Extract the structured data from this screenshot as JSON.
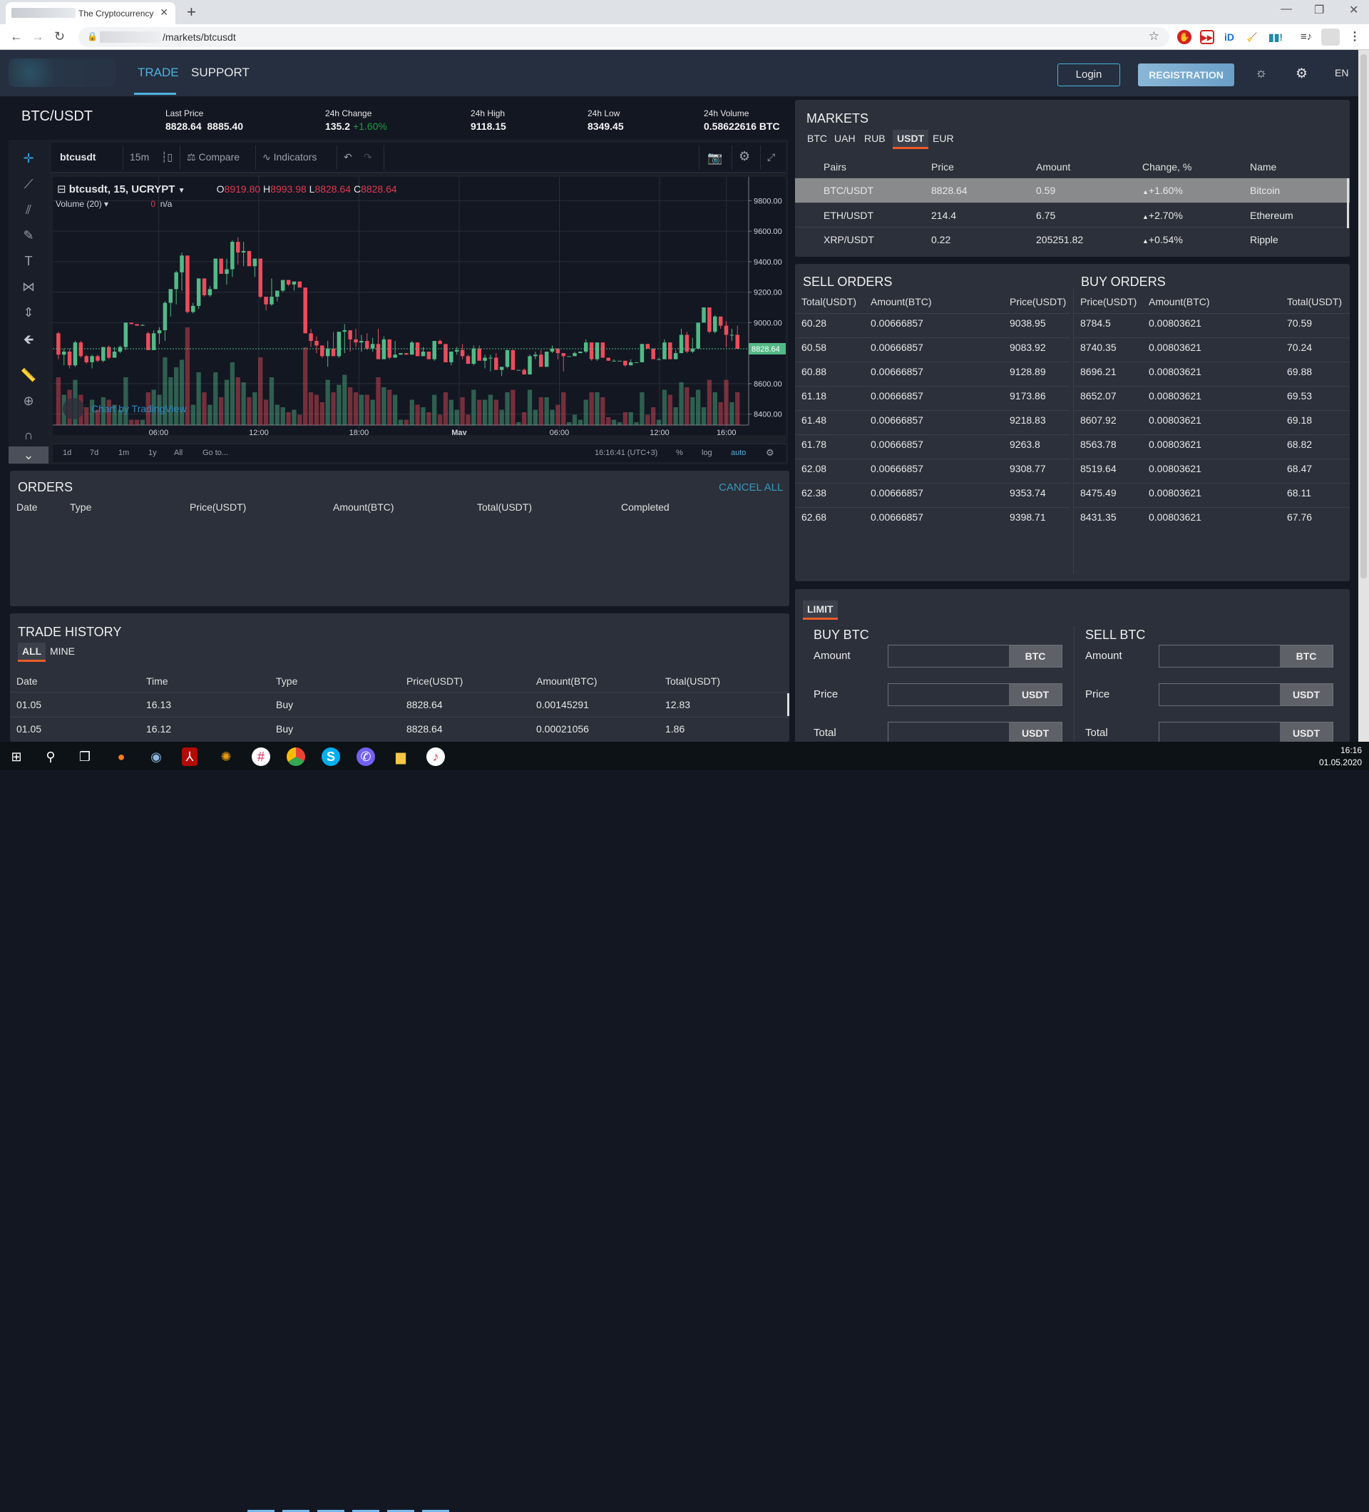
{
  "browser": {
    "tab_title": "The Cryptocurrency",
    "tab_close": "✕",
    "new_tab": "+",
    "url_path": "/markets/btcusdt",
    "window_controls": {
      "minimize": "—",
      "restore": "❐",
      "close": "✕"
    }
  },
  "header": {
    "nav": [
      {
        "label": "TRADE",
        "active": true
      },
      {
        "label": "SUPPORT",
        "active": false
      }
    ],
    "login": "Login",
    "registration": "REGISTRATION",
    "theme_icon": "☼",
    "settings_icon": "⚙",
    "language": "EN"
  },
  "ticker": {
    "pair": "BTC/USDT",
    "last_price_label": "Last Price",
    "last_price": "8828.64",
    "last_price_2": "8885.40",
    "change_label": "24h Change",
    "change_value": "135.2",
    "change_pct": "+1.60%",
    "high_label": "24h High",
    "high_value": "9118.15",
    "low_label": "24h Low",
    "low_value": "8349.45",
    "volume_label": "24h Volume",
    "volume_value": "0.58622616 BTC"
  },
  "chart_toolbar": {
    "symbol": "btcusdt",
    "interval": "15m",
    "compare": "Compare",
    "indicators": "Indicators"
  },
  "chart_legend": {
    "title": "btcusdt, 15, UCRYPT",
    "o_label": "O",
    "o": "8919.80",
    "h_label": "H",
    "h": "8993.98",
    "l_label": "L",
    "l": "8828.64",
    "c_label": "C",
    "c": "8828.64",
    "volume_label": "Volume (20)",
    "volume_value": "0",
    "volume_na": "n/a",
    "watermark": "Chart by TradingView"
  },
  "chart_bottom": {
    "ranges": [
      "1d",
      "7d",
      "1m",
      "1y",
      "All",
      "Go to..."
    ],
    "time": "16:16:41 (UTC+3)",
    "percent": "%",
    "log": "log",
    "auto": "auto"
  },
  "chart_data": {
    "type": "candlestick",
    "title": "btcusdt, 15, UCRYPT",
    "ylim": [
      8300,
      9900
    ],
    "y_ticks": [
      "9800.00",
      "9600.00",
      "9400.00",
      "9200.00",
      "9000.00",
      "8600.00",
      "8400.00"
    ],
    "x_ticks": [
      "06:00",
      "12:00",
      "18:00",
      "May",
      "06:00",
      "12:00",
      "16:00"
    ],
    "last_price_label": "8828.64",
    "last_price": 8828.64,
    "colors": {
      "up": "#53b987",
      "down": "#eb4d5c"
    },
    "candles": [
      [
        8930,
        8940,
        8760,
        8790
      ],
      [
        8790,
        8830,
        8720,
        8810
      ],
      [
        8810,
        8830,
        8700,
        8720
      ],
      [
        8720,
        8880,
        8710,
        8870
      ],
      [
        8870,
        8880,
        8770,
        8780
      ],
      [
        8780,
        8790,
        8730,
        8740
      ],
      [
        8740,
        8790,
        8700,
        8780
      ],
      [
        8780,
        8790,
        8740,
        8750
      ],
      [
        8750,
        8840,
        8740,
        8840
      ],
      [
        8840,
        8850,
        8760,
        8770
      ],
      [
        8770,
        8840,
        8770,
        8810
      ],
      [
        8810,
        8850,
        8800,
        8840
      ],
      [
        8840,
        9000,
        8820,
        9000
      ],
      [
        9000,
        9000,
        8990,
        8990
      ],
      [
        8990,
        8990,
        8980,
        8980
      ],
      [
        8980,
        8990,
        8980,
        8985
      ],
      [
        8930,
        8940,
        8820,
        8820
      ],
      [
        8820,
        8950,
        8820,
        8930
      ],
      [
        8930,
        8970,
        8860,
        8950
      ],
      [
        8950,
        9140,
        8880,
        9130
      ],
      [
        9130,
        9220,
        9040,
        9220
      ],
      [
        9220,
        9340,
        9120,
        9330
      ],
      [
        9330,
        9460,
        9210,
        9440
      ],
      [
        9440,
        9440,
        9060,
        9070
      ],
      [
        9070,
        9130,
        9060,
        9110
      ],
      [
        9110,
        9290,
        9090,
        9290
      ],
      [
        9290,
        9290,
        9170,
        9180
      ],
      [
        9180,
        9240,
        9170,
        9220
      ],
      [
        9220,
        9420,
        9220,
        9420
      ],
      [
        9420,
        9420,
        9320,
        9320
      ],
      [
        9320,
        9420,
        9250,
        9350
      ],
      [
        9350,
        9540,
        9300,
        9530
      ],
      [
        9530,
        9560,
        9380,
        9460
      ],
      [
        9460,
        9530,
        9370,
        9470
      ],
      [
        9470,
        9470,
        9370,
        9370
      ],
      [
        9370,
        9420,
        9300,
        9420
      ],
      [
        9420,
        9420,
        9160,
        9170
      ],
      [
        9170,
        9170,
        9080,
        9120
      ],
      [
        9120,
        9290,
        9110,
        9170
      ],
      [
        9170,
        9210,
        9140,
        9210
      ],
      [
        9210,
        9260,
        9200,
        9280
      ],
      [
        9280,
        9280,
        9240,
        9250
      ],
      [
        9250,
        9260,
        9210,
        9270
      ],
      [
        9270,
        9270,
        9240,
        9230
      ],
      [
        9230,
        9230,
        8930,
        8930
      ],
      [
        8930,
        8960,
        8840,
        8880
      ],
      [
        8880,
        8910,
        8800,
        8850
      ],
      [
        8850,
        8850,
        8770,
        8780
      ],
      [
        8780,
        8880,
        8710,
        8830
      ],
      [
        8830,
        8940,
        8820,
        8780
      ],
      [
        8780,
        8920,
        8770,
        8940
      ],
      [
        8940,
        8990,
        8800,
        8950
      ],
      [
        8950,
        8950,
        8810,
        8890
      ],
      [
        8890,
        8960,
        8840,
        8870
      ],
      [
        8870,
        8920,
        8810,
        8880
      ],
      [
        8880,
        8930,
        8820,
        8830
      ],
      [
        8830,
        8900,
        8810,
        8860
      ],
      [
        8860,
        8960,
        8780,
        8760
      ],
      [
        8760,
        8910,
        8770,
        8890
      ],
      [
        8890,
        8890,
        8760,
        8770
      ],
      [
        8770,
        8880,
        8770,
        8790
      ],
      [
        8790,
        8800,
        8790,
        8800
      ],
      [
        8800,
        8800,
        8790,
        8790
      ],
      [
        8790,
        8880,
        8790,
        8870
      ],
      [
        8870,
        8870,
        8800,
        8780
      ],
      [
        8780,
        8840,
        8780,
        8810
      ],
      [
        8810,
        8810,
        8770,
        8760
      ],
      [
        8760,
        8860,
        8750,
        8880
      ],
      [
        8880,
        8890,
        8860,
        8860
      ],
      [
        8860,
        8860,
        8740,
        8740
      ],
      [
        8740,
        8810,
        8720,
        8810
      ],
      [
        8810,
        8840,
        8790,
        8820
      ],
      [
        8820,
        8860,
        8760,
        8780
      ],
      [
        8780,
        8790,
        8760,
        8730
      ],
      [
        8730,
        8850,
        8720,
        8830
      ],
      [
        8830,
        8850,
        8760,
        8750
      ],
      [
        8750,
        8790,
        8700,
        8770
      ],
      [
        8770,
        8790,
        8680,
        8770
      ],
      [
        8770,
        8800,
        8710,
        8690
      ],
      [
        8690,
        8700,
        8650,
        8710
      ],
      [
        8710,
        8820,
        8700,
        8820
      ],
      [
        8820,
        8820,
        8690,
        8690
      ],
      [
        8690,
        8690,
        8690,
        8690
      ],
      [
        8690,
        8700,
        8660,
        8660
      ],
      [
        8660,
        8790,
        8660,
        8780
      ],
      [
        8780,
        8810,
        8760,
        8790
      ],
      [
        8790,
        8820,
        8720,
        8710
      ],
      [
        8710,
        8810,
        8710,
        8810
      ],
      [
        8810,
        8850,
        8800,
        8830
      ],
      [
        8830,
        8830,
        8760,
        8800
      ],
      [
        8800,
        8800,
        8680,
        8780
      ],
      [
        8780,
        8780,
        8780,
        8780
      ],
      [
        8780,
        8810,
        8780,
        8800
      ],
      [
        8800,
        8810,
        8800,
        8810
      ],
      [
        8810,
        8890,
        8800,
        8870
      ],
      [
        8870,
        8870,
        8750,
        8760
      ],
      [
        8760,
        8870,
        8750,
        8870
      ],
      [
        8870,
        8870,
        8770,
        8770
      ],
      [
        8770,
        8770,
        8750,
        8750
      ],
      [
        8750,
        8760,
        8750,
        8750
      ],
      [
        8750,
        8750,
        8750,
        8750
      ],
      [
        8750,
        8750,
        8710,
        8720
      ],
      [
        8720,
        8760,
        8720,
        8740
      ],
      [
        8740,
        8740,
        8740,
        8740
      ],
      [
        8740,
        8860,
        8740,
        8860
      ],
      [
        8860,
        8860,
        8830,
        8830
      ],
      [
        8830,
        8830,
        8770,
        8760
      ],
      [
        8760,
        8770,
        8760,
        8760
      ],
      [
        8760,
        8890,
        8760,
        8870
      ],
      [
        8870,
        8870,
        8760,
        8760
      ],
      [
        8760,
        8820,
        8760,
        8800
      ],
      [
        8800,
        8960,
        8800,
        8920
      ],
      [
        8920,
        8940,
        8800,
        8810
      ],
      [
        8810,
        8900,
        8800,
        8830
      ],
      [
        8830,
        8960,
        8830,
        9000
      ],
      [
        9000,
        9060,
        9000,
        9100
      ],
      [
        9100,
        9100,
        8930,
        8940
      ],
      [
        8940,
        9050,
        8930,
        9040
      ],
      [
        9040,
        9040,
        8960,
        8980
      ],
      [
        8980,
        9010,
        8840,
        8920
      ],
      [
        8920,
        8960,
        8880,
        8920
      ],
      [
        8920,
        8980,
        8860,
        8828.64
      ]
    ],
    "volume_ma_label": "Volume (20)"
  },
  "drawing_tools": [
    "crosshair-icon",
    "trend-line-icon",
    "pitchfork-icon",
    "brush-icon",
    "text-icon",
    "pattern-icon",
    "measure-icon",
    "back-arrow-icon",
    "ruler-icon",
    "zoom-in-icon",
    "magnet-icon",
    "hide-icon"
  ],
  "orders": {
    "title": "ORDERS",
    "cancel_all": "CANCEL ALL",
    "columns": [
      "Date",
      "Type",
      "Price(USDT)",
      "Amount(BTC)",
      "Total(USDT)",
      "Completed"
    ]
  },
  "trade_history": {
    "title": "TRADE HISTORY",
    "tabs": [
      {
        "label": "ALL",
        "active": true
      },
      {
        "label": "MINE",
        "active": false
      }
    ],
    "columns": [
      "Date",
      "Time",
      "Type",
      "Price(USDT)",
      "Amount(BTC)",
      "Total(USDT)"
    ],
    "rows": [
      {
        "date": "01.05",
        "time": "16.13",
        "type": "Buy",
        "price": "8828.64",
        "amount": "0.00145291",
        "total": "12.83"
      },
      {
        "date": "01.05",
        "time": "16.12",
        "type": "Buy",
        "price": "8828.64",
        "amount": "0.00021056",
        "total": "1.86"
      }
    ]
  },
  "markets": {
    "title": "MARKETS",
    "tabs": [
      {
        "label": "BTC"
      },
      {
        "label": "UAH"
      },
      {
        "label": "RUB"
      },
      {
        "label": "USDT",
        "active": true
      },
      {
        "label": "EUR"
      }
    ],
    "columns": [
      "Pairs",
      "Price",
      "Amount",
      "Change, %",
      "Name"
    ],
    "rows": [
      {
        "pair": "BTC/USDT",
        "price": "8828.64",
        "amount": "0.59",
        "change": "+1.60%",
        "name": "Bitcoin",
        "selected": true
      },
      {
        "pair": "ETH/USDT",
        "price": "214.4",
        "amount": "6.75",
        "change": "+2.70%",
        "name": "Ethereum"
      },
      {
        "pair": "XRP/USDT",
        "price": "0.22",
        "amount": "205251.82",
        "change": "+0.54%",
        "name": "Ripple"
      }
    ]
  },
  "sell_orders": {
    "title": "SELL ORDERS",
    "columns": [
      "Total(USDT)",
      "Amount(BTC)",
      "Price(USDT)"
    ],
    "rows": [
      {
        "total": "60.28",
        "amount": "0.00666857",
        "price": "9038.95"
      },
      {
        "total": "60.58",
        "amount": "0.00666857",
        "price": "9083.92"
      },
      {
        "total": "60.88",
        "amount": "0.00666857",
        "price": "9128.89"
      },
      {
        "total": "61.18",
        "amount": "0.00666857",
        "price": "9173.86"
      },
      {
        "total": "61.48",
        "amount": "0.00666857",
        "price": "9218.83"
      },
      {
        "total": "61.78",
        "amount": "0.00666857",
        "price": "9263.8"
      },
      {
        "total": "62.08",
        "amount": "0.00666857",
        "price": "9308.77"
      },
      {
        "total": "62.38",
        "amount": "0.00666857",
        "price": "9353.74"
      },
      {
        "total": "62.68",
        "amount": "0.00666857",
        "price": "9398.71"
      }
    ]
  },
  "buy_orders": {
    "title": "BUY ORDERS",
    "columns": [
      "Price(USDT)",
      "Amount(BTC)",
      "Total(USDT)"
    ],
    "rows": [
      {
        "price": "8784.5",
        "amount": "0.00803621",
        "total": "70.59"
      },
      {
        "price": "8740.35",
        "amount": "0.00803621",
        "total": "70.24"
      },
      {
        "price": "8696.21",
        "amount": "0.00803621",
        "total": "69.88"
      },
      {
        "price": "8652.07",
        "amount": "0.00803621",
        "total": "69.53"
      },
      {
        "price": "8607.92",
        "amount": "0.00803621",
        "total": "69.18"
      },
      {
        "price": "8563.78",
        "amount": "0.00803621",
        "total": "68.82"
      },
      {
        "price": "8519.64",
        "amount": "0.00803621",
        "total": "68.47"
      },
      {
        "price": "8475.49",
        "amount": "0.00803621",
        "total": "68.11"
      },
      {
        "price": "8431.35",
        "amount": "0.00803621",
        "total": "67.76"
      }
    ]
  },
  "limit": {
    "tab": "LIMIT",
    "buy": {
      "title": "BUY BTC",
      "fields": [
        {
          "label": "Amount",
          "unit": "BTC",
          "value": ""
        },
        {
          "label": "Price",
          "unit": "USDT",
          "value": ""
        },
        {
          "label": "Total",
          "unit": "USDT",
          "value": ""
        }
      ]
    },
    "sell": {
      "title": "SELL BTC",
      "fields": [
        {
          "label": "Amount",
          "unit": "BTC",
          "value": ""
        },
        {
          "label": "Price",
          "unit": "USDT",
          "value": ""
        },
        {
          "label": "Total",
          "unit": "USDT",
          "value": ""
        }
      ]
    }
  },
  "taskbar": {
    "time": "16:16",
    "date": "01.05.2020"
  }
}
